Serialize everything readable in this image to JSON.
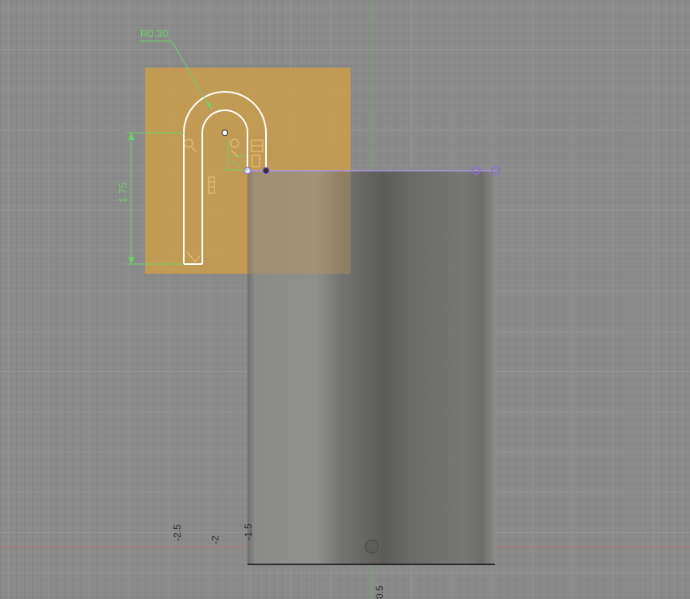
{
  "viewport": {
    "background": "#8b8b8b",
    "grid_color": "#a0a0a0"
  },
  "sketch": {
    "sketch_plane_color": "#c79b4c",
    "profile_color": "#ffffff",
    "constraint_line_color": "#b49be8",
    "dimension_color": "#6bd36b",
    "radius_dimension": "R0.30",
    "height_dimension": "1.75"
  },
  "body": {
    "color": "#7a7a78"
  },
  "axes": {
    "x_axis_color": "#e06565",
    "y_axis_color": "#3fc93f",
    "tick_labels": [
      "-2.5",
      "-2",
      "-1.5",
      "0.5"
    ]
  }
}
